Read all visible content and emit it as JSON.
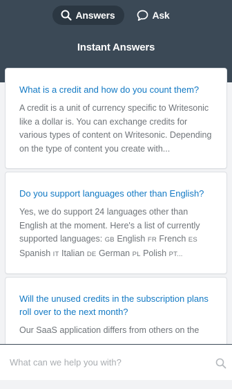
{
  "header": {
    "tabs": [
      {
        "label": "Answers",
        "icon": "search-icon",
        "active": true
      },
      {
        "label": "Ask",
        "icon": "chat-bubble-icon",
        "active": false
      }
    ],
    "title": "Instant Answers"
  },
  "articles": [
    {
      "question": "What is a credit and how do you count them?",
      "snippet": "A credit is a unit of currency specific to Writesonic like a dollar is. You can exchange credits for various types of content on Writesonic. Depending on the type of content you create with..."
    },
    {
      "question": "Do you support languages other than English?",
      "snippet_intro": "Yes, we do support 24 languages other than English at the moment. Here's a list of currently supported languages:",
      "languages": [
        {
          "code": "GB",
          "name": "English"
        },
        {
          "code": "FR",
          "name": "French"
        },
        {
          "code": "ES",
          "name": "Spanish"
        },
        {
          "code": "IT",
          "name": "Italian"
        },
        {
          "code": "DE",
          "name": "German"
        },
        {
          "code": "PL",
          "name": "Polish"
        }
      ],
      "snippet_tail": "PT..."
    },
    {
      "question": "Will the unused credits in the subscription plans roll over to the next month?",
      "snippet": "Our SaaS application differs from others on the"
    }
  ],
  "search": {
    "placeholder": "What can we help you with?",
    "value": ""
  },
  "colors": {
    "header_bg": "#3b4956",
    "active_tab_bg": "#2b3742",
    "link": "#1279c4",
    "snippet": "#6f7479"
  }
}
